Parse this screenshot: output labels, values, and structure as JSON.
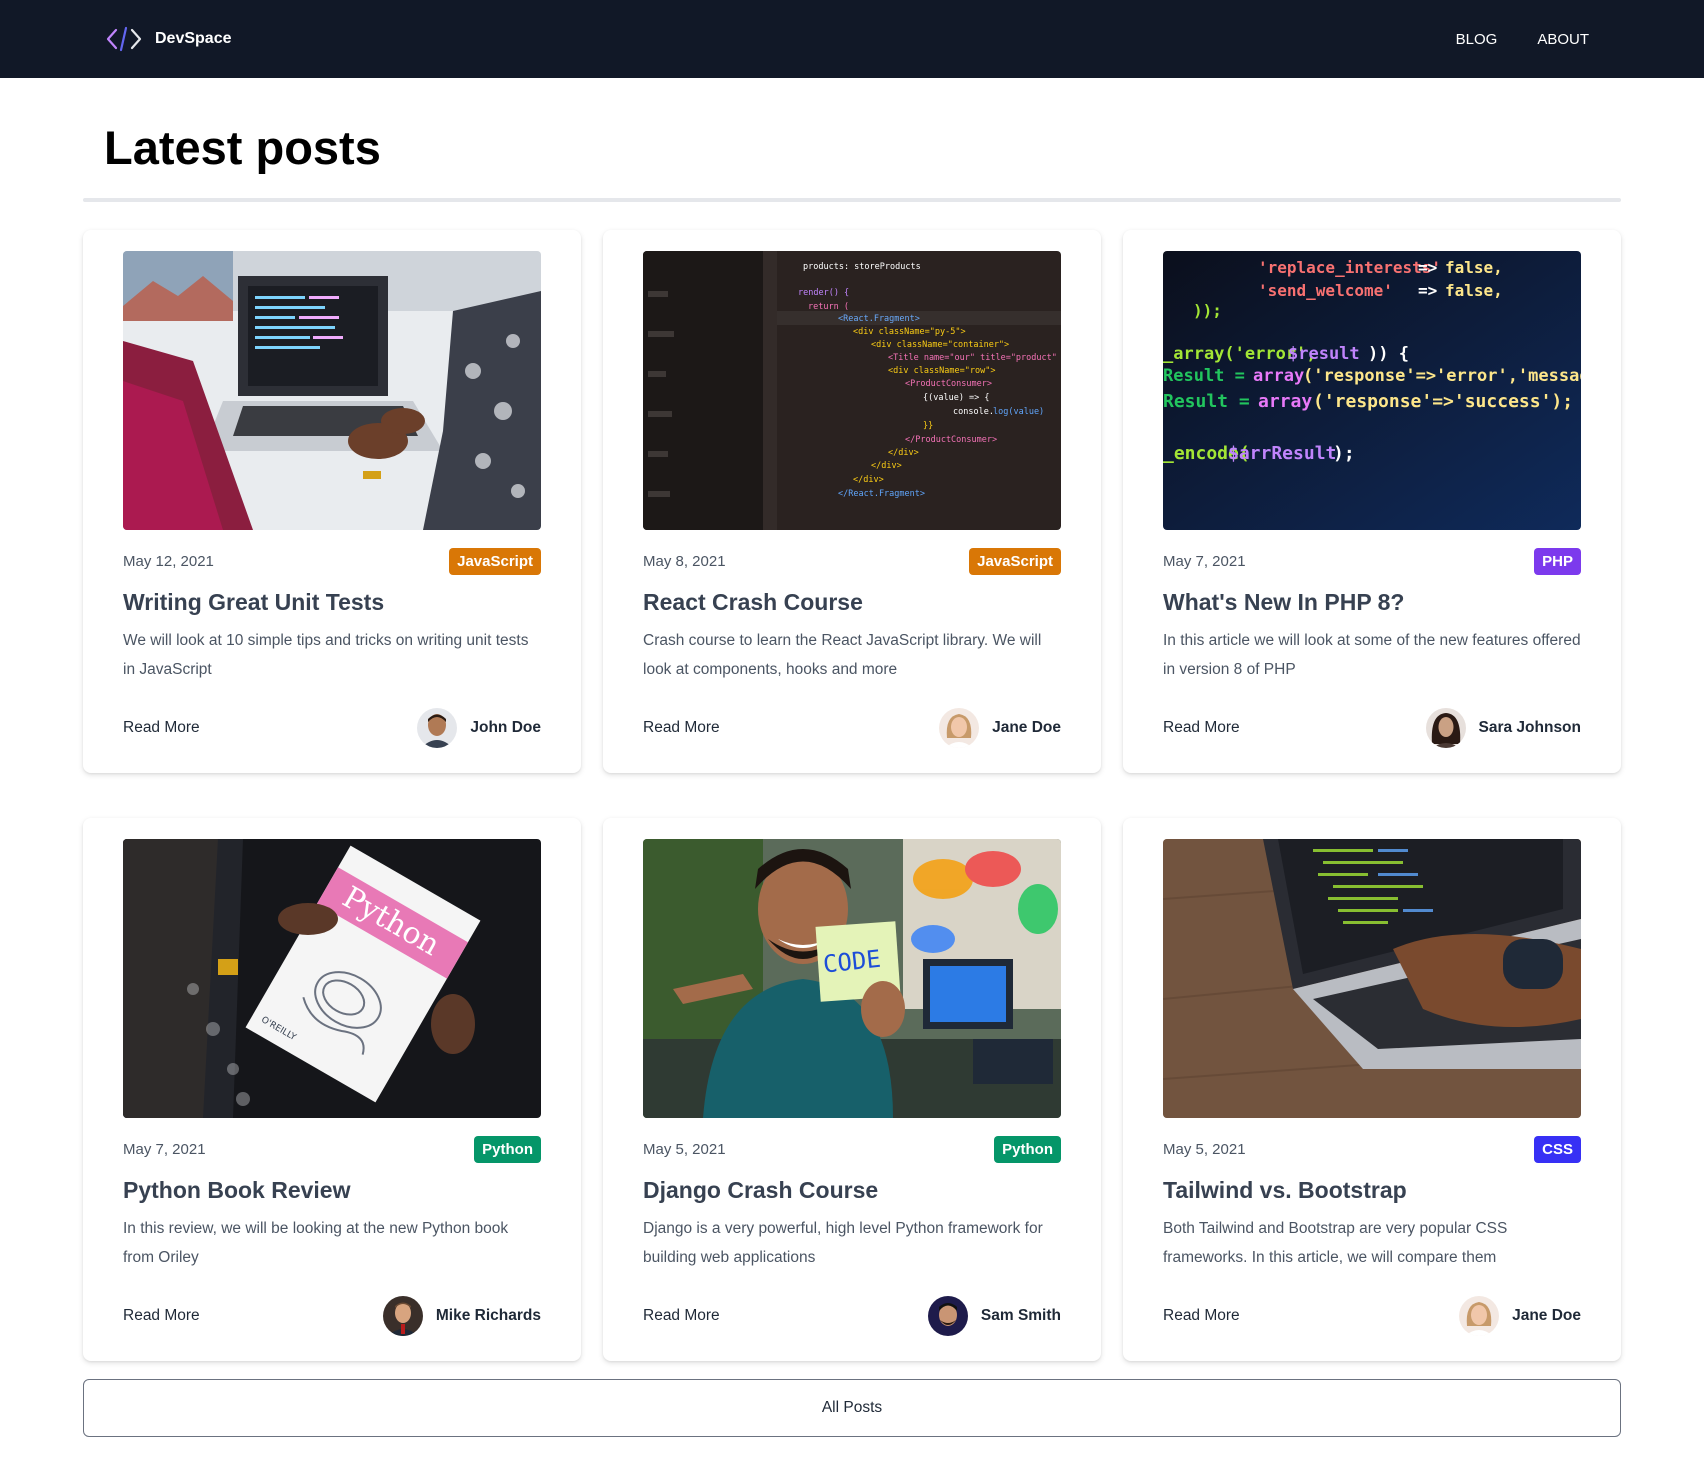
{
  "nav": {
    "brand": "DevSpace",
    "links": [
      "BLOG",
      "ABOUT"
    ]
  },
  "page_title": "Latest posts",
  "colors": {
    "navbar_bg": "#111827",
    "javascript": "#d97706",
    "php": "#7c3aed",
    "python": "#059669",
    "css": "#3730f5"
  },
  "read_more_label": "Read More",
  "all_posts_label": "All Posts",
  "posts": [
    {
      "date": "May 12, 2021",
      "category": "JavaScript",
      "title": "Writing Great Unit Tests",
      "excerpt": "We will look at 10 simple tips and tricks on writing unit tests in JavaScript",
      "author": "John Doe",
      "image": "laptop-code-photo"
    },
    {
      "date": "May 8, 2021",
      "category": "JavaScript",
      "title": "React Crash Course",
      "excerpt": "Crash course to learn the React JavaScript library. We will look at components, hooks and more",
      "author": "Jane Doe",
      "image": "react-code-photo"
    },
    {
      "date": "May 7, 2021",
      "category": "PHP",
      "title": "What's New In PHP 8?",
      "excerpt": "In this article we will look at some of the new features offered in version 8 of PHP",
      "author": "Sara Johnson",
      "image": "php-code-photo"
    },
    {
      "date": "May 7, 2021",
      "category": "Python",
      "title": "Python Book Review",
      "excerpt": "In this review, we will be looking at the new Python book from Oriley",
      "author": "Mike Richards",
      "image": "python-book-photo"
    },
    {
      "date": "May 5, 2021",
      "category": "Python",
      "title": "Django Crash Course",
      "excerpt": "Django is a very powerful, high level Python framework for building web applications",
      "author": "Sam Smith",
      "image": "code-sticky-note-photo"
    },
    {
      "date": "May 5, 2021",
      "category": "CSS",
      "title": "Tailwind vs. Bootstrap",
      "excerpt": "Both Tailwind and Bootstrap are very popular CSS frameworks. In this article, we will compare them",
      "author": "Jane Doe",
      "image": "laptop-typing-photo"
    }
  ]
}
